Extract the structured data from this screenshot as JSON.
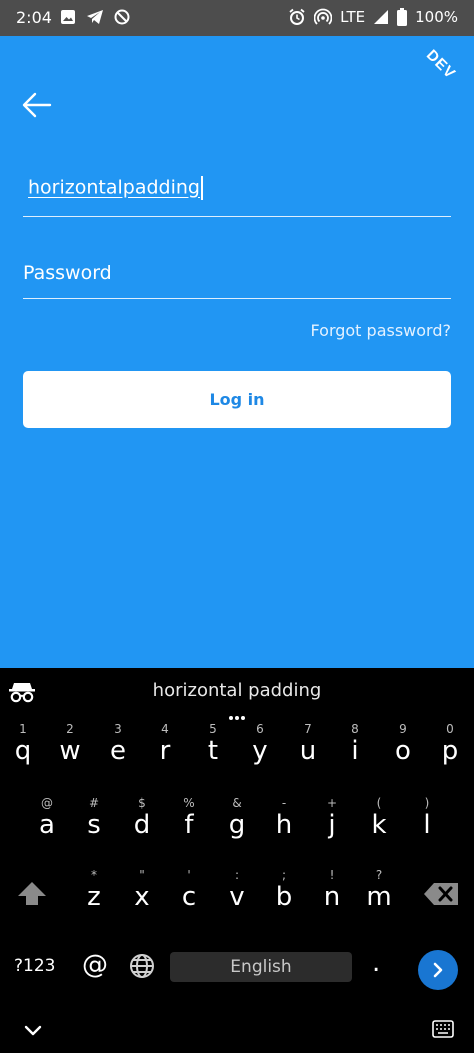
{
  "status_bar": {
    "time": "2:04",
    "network": "LTE",
    "battery": "100%",
    "icons_left": [
      "image-icon",
      "telegram-icon",
      "circle-slash-icon"
    ],
    "icons_right": [
      "alarm-icon",
      "hotspot-icon",
      "signal-icon",
      "battery-icon"
    ]
  },
  "app": {
    "env_badge": "DEV",
    "username_value": "horizontalpadding",
    "password_placeholder": "Password",
    "forgot_password": "Forgot password?",
    "login_button": "Log in",
    "colors": {
      "background": "#2196f3",
      "button_text": "#1e88e5"
    }
  },
  "keyboard": {
    "suggestion": "horizontal padding",
    "row1": [
      {
        "hint": "1",
        "key": "q"
      },
      {
        "hint": "2",
        "key": "w"
      },
      {
        "hint": "3",
        "key": "e"
      },
      {
        "hint": "4",
        "key": "r"
      },
      {
        "hint": "5",
        "key": "t"
      },
      {
        "hint": "6",
        "key": "y"
      },
      {
        "hint": "7",
        "key": "u"
      },
      {
        "hint": "8",
        "key": "i"
      },
      {
        "hint": "9",
        "key": "o"
      },
      {
        "hint": "0",
        "key": "p"
      }
    ],
    "row2": [
      {
        "hint": "@",
        "key": "a"
      },
      {
        "hint": "#",
        "key": "s"
      },
      {
        "hint": "$",
        "key": "d"
      },
      {
        "hint": "%",
        "key": "f"
      },
      {
        "hint": "&",
        "key": "g"
      },
      {
        "hint": "-",
        "key": "h"
      },
      {
        "hint": "+",
        "key": "j"
      },
      {
        "hint": "(",
        "key": "k"
      },
      {
        "hint": ")",
        "key": "l"
      }
    ],
    "row3": [
      {
        "hint": "*",
        "key": "z"
      },
      {
        "hint": "\"",
        "key": "x"
      },
      {
        "hint": "'",
        "key": "c"
      },
      {
        "hint": ":",
        "key": "v"
      },
      {
        "hint": ";",
        "key": "b"
      },
      {
        "hint": "!",
        "key": "n"
      },
      {
        "hint": "?",
        "key": "m"
      }
    ],
    "symbols_key": "?123",
    "at_key": "@",
    "space_label": "English",
    "period_key": ".",
    "go_color": "#1976d2"
  }
}
